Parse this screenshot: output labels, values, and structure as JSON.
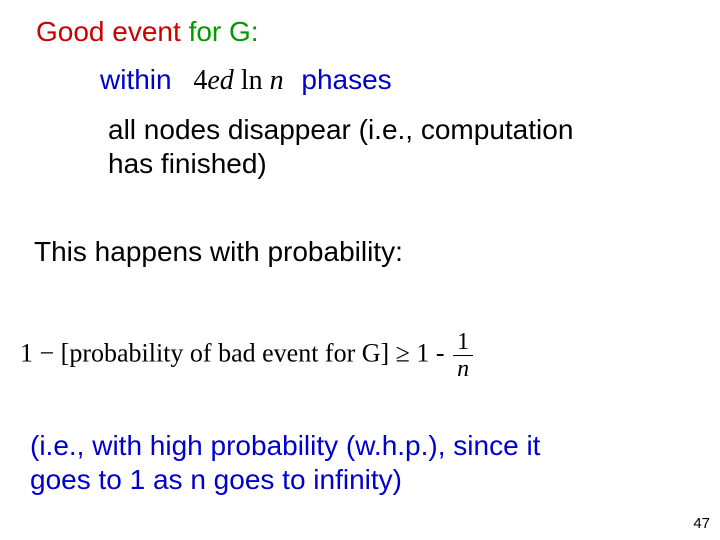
{
  "title_part1": "Good event ",
  "title_part2": "for G:",
  "within": "within",
  "formula_phases": "4",
  "formula_ed": "ed",
  "formula_ln": " ln ",
  "formula_n": "n",
  "phases": "phases",
  "body1_line1": "all nodes disappear (i.e., computation",
  "body1_line2": "has finished)",
  "happens": "This happens with probability:",
  "prob_prefix": "1 − [probability of bad event for G] ≥ 1 - ",
  "frac_num": "1",
  "frac_den": "n",
  "foot_line1": "(i.e., with high probability (w.h.p.), since it",
  "foot_line2": "goes to 1 as n goes to infinity)",
  "page": "47"
}
